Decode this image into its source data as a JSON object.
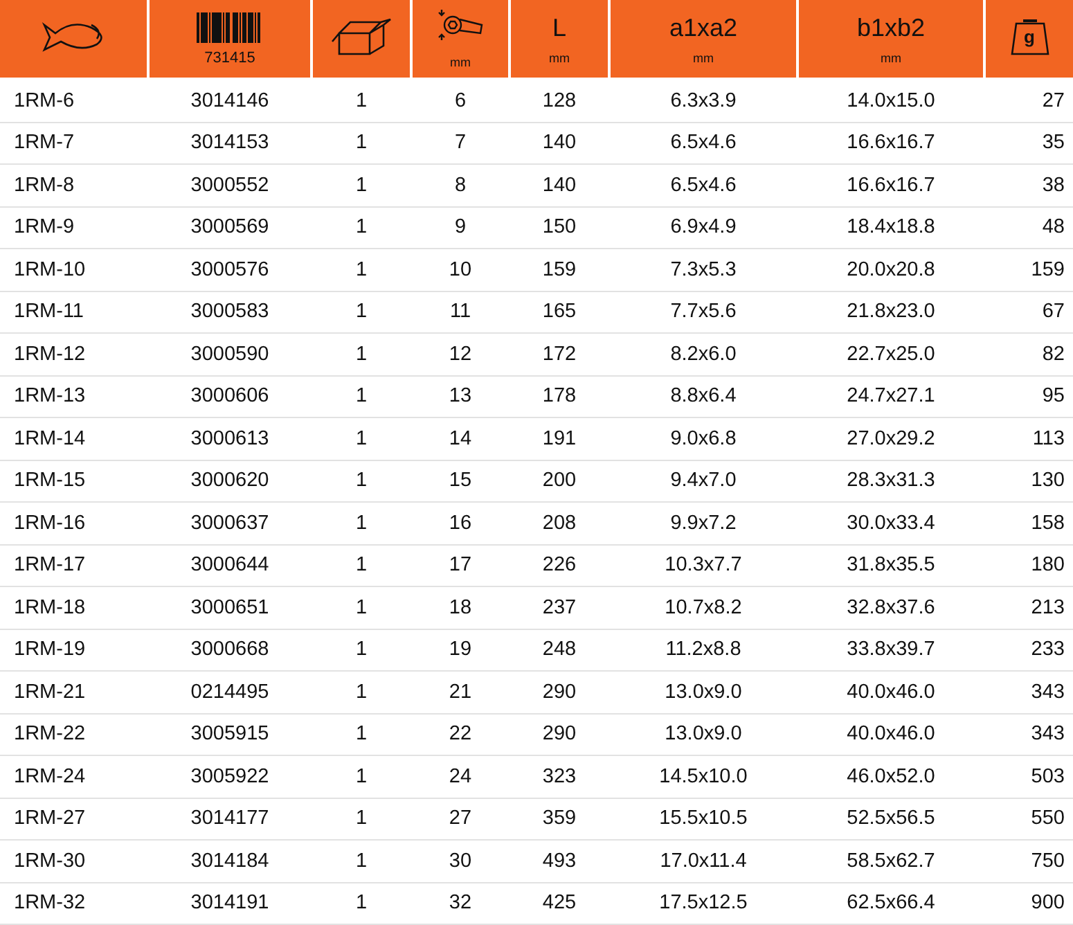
{
  "columns": [
    {
      "kind": "fish"
    },
    {
      "kind": "barcode",
      "label": "731415"
    },
    {
      "kind": "box"
    },
    {
      "kind": "wrench",
      "unit": "mm"
    },
    {
      "kind": "text",
      "label": "L",
      "unit": "mm"
    },
    {
      "kind": "text",
      "label": "a1xa2",
      "unit": "mm"
    },
    {
      "kind": "text",
      "label": "b1xb2",
      "unit": "mm"
    },
    {
      "kind": "weight",
      "label": "g"
    }
  ],
  "rows": [
    [
      "1RM-6",
      "3014146",
      "1",
      "6",
      "128",
      "6.3x3.9",
      "14.0x15.0",
      "27"
    ],
    [
      "1RM-7",
      "3014153",
      "1",
      "7",
      "140",
      "6.5x4.6",
      "16.6x16.7",
      "35"
    ],
    [
      "1RM-8",
      "3000552",
      "1",
      "8",
      "140",
      "6.5x4.6",
      "16.6x16.7",
      "38"
    ],
    [
      "1RM-9",
      "3000569",
      "1",
      "9",
      "150",
      "6.9x4.9",
      "18.4x18.8",
      "48"
    ],
    [
      "1RM-10",
      "3000576",
      "1",
      "10",
      "159",
      "7.3x5.3",
      "20.0x20.8",
      "159"
    ],
    [
      "1RM-11",
      "3000583",
      "1",
      "11",
      "165",
      "7.7x5.6",
      "21.8x23.0",
      "67"
    ],
    [
      "1RM-12",
      "3000590",
      "1",
      "12",
      "172",
      "8.2x6.0",
      "22.7x25.0",
      "82"
    ],
    [
      "1RM-13",
      "3000606",
      "1",
      "13",
      "178",
      "8.8x6.4",
      "24.7x27.1",
      "95"
    ],
    [
      "1RM-14",
      "3000613",
      "1",
      "14",
      "191",
      "9.0x6.8",
      "27.0x29.2",
      "113"
    ],
    [
      "1RM-15",
      "3000620",
      "1",
      "15",
      "200",
      "9.4x7.0",
      "28.3x31.3",
      "130"
    ],
    [
      "1RM-16",
      "3000637",
      "1",
      "16",
      "208",
      "9.9x7.2",
      "30.0x33.4",
      "158"
    ],
    [
      "1RM-17",
      "3000644",
      "1",
      "17",
      "226",
      "10.3x7.7",
      "31.8x35.5",
      "180"
    ],
    [
      "1RM-18",
      "3000651",
      "1",
      "18",
      "237",
      "10.7x8.2",
      "32.8x37.6",
      "213"
    ],
    [
      "1RM-19",
      "3000668",
      "1",
      "19",
      "248",
      "11.2x8.8",
      "33.8x39.7",
      "233"
    ],
    [
      "1RM-21",
      "0214495",
      "1",
      "21",
      "290",
      "13.0x9.0",
      "40.0x46.0",
      "343"
    ],
    [
      "1RM-22",
      "3005915",
      "1",
      "22",
      "290",
      "13.0x9.0",
      "40.0x46.0",
      "343"
    ],
    [
      "1RM-24",
      "3005922",
      "1",
      "24",
      "323",
      "14.5x10.0",
      "46.0x52.0",
      "503"
    ],
    [
      "1RM-27",
      "3014177",
      "1",
      "27",
      "359",
      "15.5x10.5",
      "52.5x56.5",
      "550"
    ],
    [
      "1RM-30",
      "3014184",
      "1",
      "30",
      "493",
      "17.0x11.4",
      "58.5x62.7",
      "750"
    ],
    [
      "1RM-32",
      "3014191",
      "1",
      "32",
      "425",
      "17.5x12.5",
      "62.5x66.4",
      "900"
    ]
  ]
}
